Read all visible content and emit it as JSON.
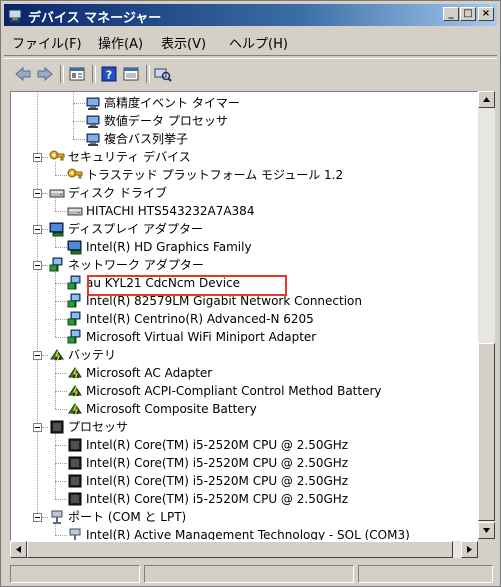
{
  "window": {
    "title": "デバイス マネージャー"
  },
  "titlebar_buttons": {
    "minimize": "_",
    "maximize": "□",
    "close": "×"
  },
  "menu": [
    "ファイル(F)",
    "操作(A)",
    "表示(V)",
    "ヘルプ(H)"
  ],
  "tree": [
    {
      "label": "高精度イベント タイマー",
      "icon": "system-device-icon",
      "expander": false
    },
    {
      "label": "数値データ プロセッサ",
      "icon": "system-device-icon",
      "expander": false
    },
    {
      "label": "複合バス列挙子",
      "icon": "system-device-icon",
      "expander": false
    },
    {
      "label": "セキュリティ デバイス",
      "icon": "security-key-icon",
      "expander": true
    },
    {
      "label": "トラステッド プラットフォーム モジュール 1.2",
      "icon": "security-key-icon",
      "expander": false
    },
    {
      "label": "ディスク ドライブ",
      "icon": "disk-drive-icon",
      "expander": true
    },
    {
      "label": "HITACHI HTS543232A7A384",
      "icon": "disk-drive-icon",
      "expander": false
    },
    {
      "label": "ディスプレイ アダプター",
      "icon": "display-adapter-icon",
      "expander": true
    },
    {
      "label": "Intel(R) HD Graphics Family",
      "icon": "display-adapter-icon",
      "expander": false
    },
    {
      "label": "ネットワーク アダプター",
      "icon": "network-adapter-icon",
      "expander": true
    },
    {
      "label": "au KYL21 CdcNcm Device",
      "icon": "network-adapter-icon",
      "expander": false
    },
    {
      "label": "Intel(R) 82579LM Gigabit Network Connection",
      "icon": "network-adapter-icon",
      "expander": false
    },
    {
      "label": "Intel(R) Centrino(R) Advanced-N 6205",
      "icon": "network-adapter-icon",
      "expander": false
    },
    {
      "label": "Microsoft Virtual WiFi Miniport Adapter",
      "icon": "network-adapter-icon",
      "expander": false
    },
    {
      "label": "バッテリ",
      "icon": "battery-icon",
      "expander": true
    },
    {
      "label": "Microsoft AC Adapter",
      "icon": "battery-icon",
      "expander": false
    },
    {
      "label": "Microsoft ACPI-Compliant Control Method Battery",
      "icon": "battery-icon",
      "expander": false
    },
    {
      "label": "Microsoft Composite Battery",
      "icon": "battery-icon",
      "expander": false
    },
    {
      "label": "プロセッサ",
      "icon": "processor-icon",
      "expander": true
    },
    {
      "label": "Intel(R) Core(TM) i5-2520M CPU @ 2.50GHz",
      "icon": "processor-icon",
      "expander": false
    },
    {
      "label": "Intel(R) Core(TM) i5-2520M CPU @ 2.50GHz",
      "icon": "processor-icon",
      "expander": false
    },
    {
      "label": "Intel(R) Core(TM) i5-2520M CPU @ 2.50GHz",
      "icon": "processor-icon",
      "expander": false
    },
    {
      "label": "Intel(R) Core(TM) i5-2520M CPU @ 2.50GHz",
      "icon": "processor-icon",
      "expander": false
    },
    {
      "label": "ポート (COM と LPT)",
      "icon": "port-icon",
      "expander": true
    },
    {
      "label": "Intel(R) Active Management Technology - SOL (COM3)",
      "icon": "port-icon",
      "expander": false
    }
  ],
  "colors": {
    "highlight_border": "#e03a2a",
    "titlebar": "#0a246a"
  }
}
